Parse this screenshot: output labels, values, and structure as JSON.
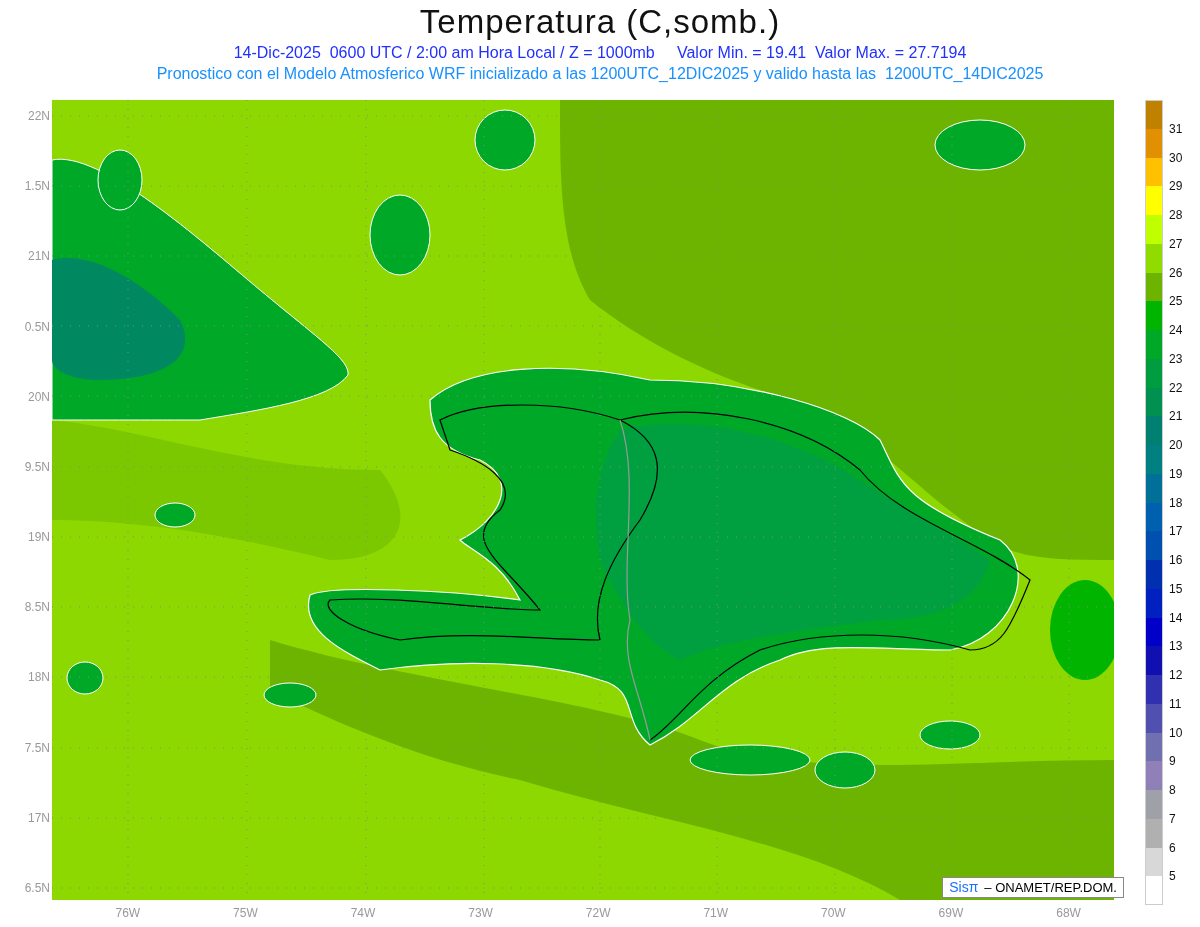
{
  "title": "Temperatura (C,somb.)",
  "subtitle_lines": [
    "14-Dic-2025  0600 UTC / 2:00 am Hora Local / Z = 1000mb     Valor Min. = 19.41  Valor Max. = 27.7194",
    "Pronostico con el Modelo Atmosferico WRF inicializado a las 1200UTC_12DIC2025 y valido hasta las  1200UTC_14DIC2025"
  ],
  "lat_labels": [
    "22N",
    "1.5N",
    "21N",
    "0.5N",
    "20N",
    "9.5N",
    "19N",
    "8.5N",
    "18N",
    "7.5N",
    "17N",
    "6.5N"
  ],
  "lon_labels": [
    "76W",
    "75W",
    "74W",
    "73W",
    "72W",
    "71W",
    "70W",
    "69W",
    "68W"
  ],
  "credit": {
    "logo": "Sisπ",
    "text": "– ONAMET/REP.DOM."
  },
  "legend": [
    {
      "color": "#c08000",
      "label": "31"
    },
    {
      "color": "#e09000",
      "label": "30"
    },
    {
      "color": "#ffc000",
      "label": "29"
    },
    {
      "color": "#ffff00",
      "label": "28"
    },
    {
      "color": "#c0ff00",
      "label": "27"
    },
    {
      "color": "#90dc00",
      "label": "26"
    },
    {
      "color": "#6cb400",
      "label": "25"
    },
    {
      "color": "#00b400",
      "label": "24"
    },
    {
      "color": "#00a828",
      "label": "23"
    },
    {
      "color": "#009c40",
      "label": "22"
    },
    {
      "color": "#009050",
      "label": "21"
    },
    {
      "color": "#008070",
      "label": "20"
    },
    {
      "color": "#008080",
      "label": "19"
    },
    {
      "color": "#007098",
      "label": "18"
    },
    {
      "color": "#0060b0",
      "label": "17"
    },
    {
      "color": "#0050b0",
      "label": "16"
    },
    {
      "color": "#0030b0",
      "label": "15"
    },
    {
      "color": "#0020c0",
      "label": "14"
    },
    {
      "color": "#0000c8",
      "label": "13"
    },
    {
      "color": "#1010b0",
      "label": "12"
    },
    {
      "color": "#3030b0",
      "label": "11"
    },
    {
      "color": "#5050b0",
      "label": "10"
    },
    {
      "color": "#7070b0",
      "label": "9"
    },
    {
      "color": "#9080b8",
      "label": "8"
    },
    {
      "color": "#a0a0a8",
      "label": "7"
    },
    {
      "color": "#b0b0b0",
      "label": "6"
    },
    {
      "color": "#d8d8d8",
      "label": "5"
    },
    {
      "color": "#ffffff"
    }
  ]
}
